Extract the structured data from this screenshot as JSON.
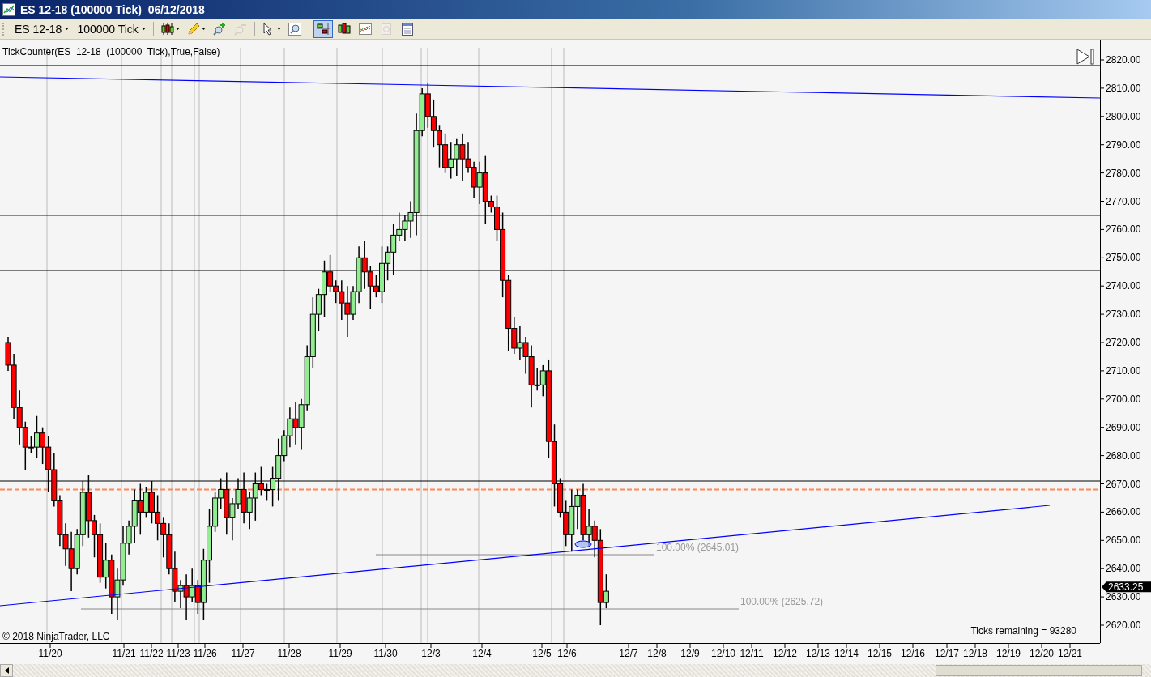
{
  "window": {
    "title": "ES 12-18 (100000 Tick)  06/12/2018"
  },
  "toolbar": {
    "instrument": "ES 12-18",
    "interval": "100000 Tick",
    "tools": [
      {
        "kind": "chart-style",
        "selected": false,
        "disabled": false
      },
      {
        "kind": "draw",
        "selected": false,
        "disabled": false
      },
      {
        "kind": "zoom-in",
        "selected": false,
        "disabled": false
      },
      {
        "kind": "zoom-out",
        "selected": false,
        "disabled": true
      },
      {
        "kind": "pointer",
        "selected": false,
        "disabled": false
      },
      {
        "kind": "magnifier",
        "selected": false,
        "disabled": false
      },
      {
        "kind": "split",
        "selected": true,
        "disabled": false
      },
      {
        "kind": "bars",
        "selected": false,
        "disabled": false
      },
      {
        "kind": "indicators",
        "selected": false,
        "disabled": false
      },
      {
        "kind": "dollar",
        "selected": false,
        "disabled": true
      },
      {
        "kind": "properties",
        "selected": false,
        "disabled": false
      }
    ]
  },
  "chart": {
    "indicator_label": "TickCounter(ES  12-18  (100000  Tick),True,False)",
    "y_labels": [
      "2820.00",
      "2810.00",
      "2800.00",
      "2790.00",
      "2780.00",
      "2770.00",
      "2760.00",
      "2750.00",
      "2740.00",
      "2730.00",
      "2720.00",
      "2710.00",
      "2700.00",
      "2690.00",
      "2680.00",
      "2670.00",
      "2660.00",
      "2650.00",
      "2640.00",
      "2630.00",
      "2620.00"
    ],
    "x_labels": [
      "11/20",
      "11/21",
      "11/22",
      "11/23",
      "11/26",
      "11/27",
      "11/28",
      "11/29",
      "11/30",
      "12/3",
      "12/4",
      "12/5",
      "12/6",
      "12/7",
      "12/8",
      "12/9",
      "12/10",
      "12/11",
      "12/12",
      "12/13",
      "12/14",
      "12/15",
      "12/16",
      "12/17",
      "12/18",
      "12/19",
      "12/20",
      "12/21"
    ],
    "price_marker": "2633.25",
    "fib_labels": [
      "100.00% (2645.01)",
      "100.00% (2625.72)"
    ],
    "copyright": "© 2018 NinjaTrader, LLC",
    "ticks_remaining": "Ticks remaining = 93280"
  }
}
